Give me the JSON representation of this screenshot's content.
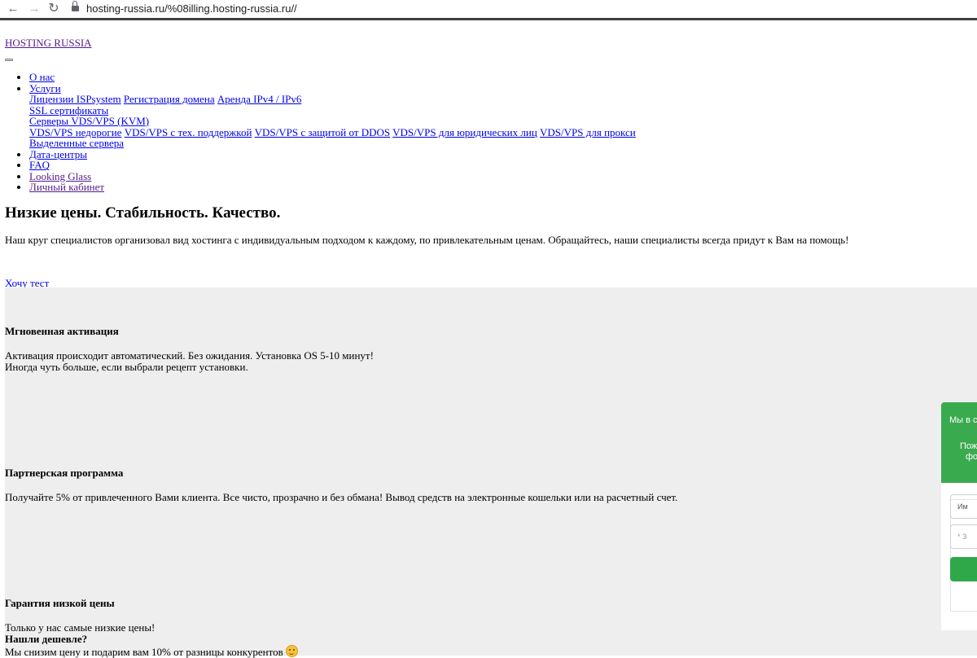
{
  "browser": {
    "url": "hosting-russia.ru/%08illing.hosting-russia.ru//"
  },
  "header": {
    "brand": "HOSTING RUSSIA"
  },
  "menu": {
    "about": "О нас",
    "services": "Услуги",
    "isp_licenses": "Лицензии ISPsystem",
    "domain_registration": "Регистрация домена",
    "ip_rent": "Аренда IPv4 / IPv6",
    "ssl": "SSL сертификаты",
    "servers_vds": "Серверы  VDS/VPS (KVM)",
    "vds_cheap": "VDS/VPS недорогие",
    "vds_support": "VDS/VPS с тех. поддержкой",
    "vds_ddos": "VDS/VPS с защитой от DDOS",
    "vds_legal": "VDS/VPS для юридических лиц",
    "vds_proxy": "VDS/VPS для прокси",
    "dedicated": "Выделенные сервера",
    "datacenters": "Дата-центры",
    "faq": "FAQ",
    "looking_glass": "Looking Glass",
    "cabinet": "Личный кабинет"
  },
  "hero": {
    "title": "Низкие цены. Стабильность. Качество.",
    "text": "Наш круг специалистов организовал вид хостинга с индивидуальным подходом к каждому, по привлекательным ценам. Обращайтесь, наши специалисты всегда придут к Вам на помощь!",
    "cta": "Хочу тест"
  },
  "features": {
    "activation": {
      "title": "Мгновенная активация",
      "line1": "Активация происходит автоматический. Без ожидания. Установка OS 5-10 минут!",
      "line2": "Иногда чуть больше, если выбрали рецепт установки."
    },
    "partner": {
      "title": "Партнерская программа",
      "text": "Получайте 5% от привлеченного Вами клиента. Все чисто, прозрачно и без обмана! Вывод средств на электронные кошельки или на расчетный счет."
    },
    "guarantee": {
      "title": "Гарантия низкой цены",
      "line1": "Только у нас самые низкие цены!",
      "line2": "Нашли дешевле?",
      "line3": "Мы снизим цену и подарим вам 10% от разницы конкурентов"
    }
  },
  "widget": {
    "head_line1": "Мы в с",
    "head_line2": "Пож",
    "head_line3": "фо",
    "field1_placeholder": "Им",
    "field2_placeholder": "* З"
  },
  "colors": {
    "widget_green": "#3aaa4e",
    "section_gray": "#eeeeee",
    "link": "#0000ee",
    "link_visited": "#551a8b"
  }
}
